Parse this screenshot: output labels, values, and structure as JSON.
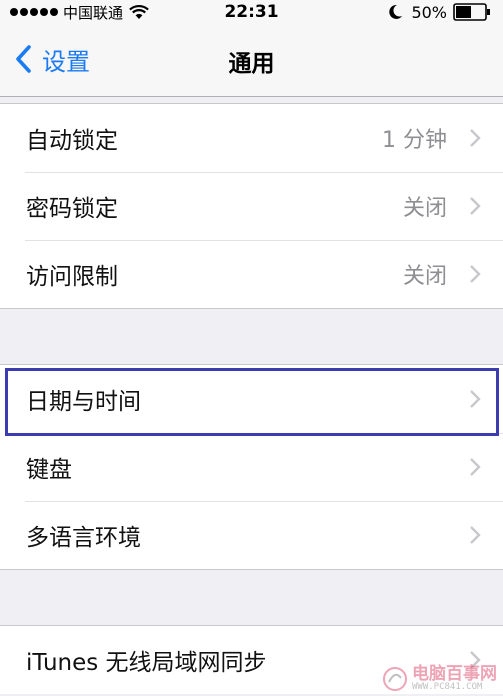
{
  "status_bar": {
    "carrier": "中国联通",
    "time": "22:31",
    "battery": "50%"
  },
  "nav": {
    "back_label": "设置",
    "title": "通用"
  },
  "groups": [
    {
      "rows": [
        {
          "label": "自动锁定",
          "value": "1 分钟"
        },
        {
          "label": "密码锁定",
          "value": "关闭"
        },
        {
          "label": "访问限制",
          "value": "关闭"
        }
      ]
    },
    {
      "rows": [
        {
          "label": "日期与时间"
        },
        {
          "label": "键盘"
        },
        {
          "label": "多语言环境"
        }
      ]
    },
    {
      "rows": [
        {
          "label": "iTunes 无线局域网同步"
        }
      ]
    }
  ],
  "watermark": {
    "cn": "电脑百事网",
    "en": "WWW.PC841.COM"
  },
  "colors": {
    "accent": "#1a7bf2",
    "highlight": "#3c3cb0",
    "secondary_text": "#8e8e93"
  }
}
